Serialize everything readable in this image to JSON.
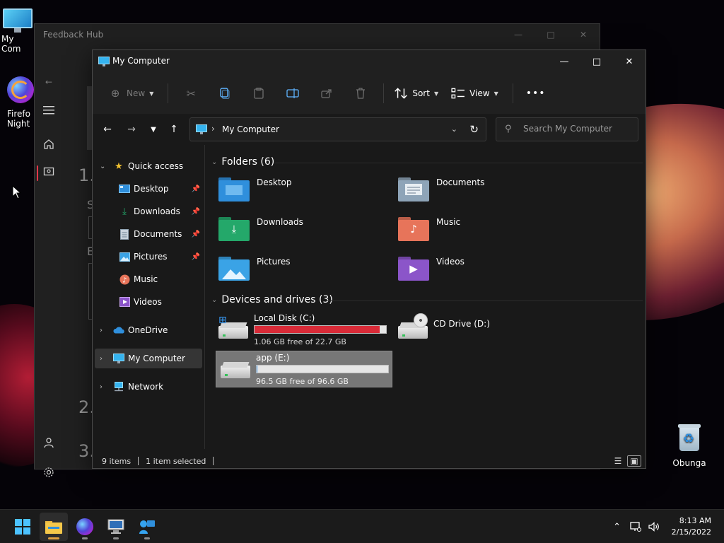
{
  "desktop": {
    "icons": [
      {
        "label": "My Com"
      },
      {
        "label": "Firefo"
      },
      {
        "label": "Night"
      },
      {
        "label": "Obunga"
      }
    ]
  },
  "feedback_hub": {
    "title": "Feedback Hub",
    "peek": {
      "step1": "1.",
      "step2": "2.",
      "step3": "3.",
      "letter_s": "S",
      "letter_e": "E"
    }
  },
  "explorer": {
    "title": "My Computer",
    "toolbar": {
      "new_label": "New",
      "sort_label": "Sort",
      "view_label": "View",
      "more_label": "•••"
    },
    "address": {
      "location": "My Computer"
    },
    "search": {
      "placeholder": "Search My Computer"
    },
    "nav": {
      "quick_access": "Quick access",
      "items": [
        {
          "label": "Desktop",
          "icon": "desktop-icon"
        },
        {
          "label": "Downloads",
          "icon": "downloads-icon"
        },
        {
          "label": "Documents",
          "icon": "documents-icon"
        },
        {
          "label": "Pictures",
          "icon": "pictures-icon"
        },
        {
          "label": "Music",
          "icon": "music-icon"
        },
        {
          "label": "Videos",
          "icon": "videos-icon"
        }
      ],
      "onedrive": "OneDrive",
      "my_computer": "My Computer",
      "network": "Network"
    },
    "folders_header": "Folders (6)",
    "folders": [
      {
        "label": "Desktop",
        "color": "#2f8fdc"
      },
      {
        "label": "Documents",
        "color": "#8ea4b8"
      },
      {
        "label": "Downloads",
        "color": "#24a86a"
      },
      {
        "label": "Music",
        "color": "#e7745a"
      },
      {
        "label": "Pictures",
        "color": "#3aa3e6"
      },
      {
        "label": "Videos",
        "color": "#8b55c9"
      }
    ],
    "drives_header": "Devices and drives (3)",
    "drives": [
      {
        "name": "Local Disk (C:)",
        "free": "1.06 GB free of 22.7 GB",
        "used_fraction": 0.953,
        "bar_color": "#d92b38"
      },
      {
        "name": "CD Drive (D:)"
      },
      {
        "name": "app (E:)",
        "free": "96.5 GB free of 96.6 GB",
        "used_fraction": 0.001,
        "bar_color": "#2e8be0"
      }
    ],
    "status": {
      "items": "9 items",
      "selected": "1 item selected"
    }
  },
  "taskbar": {
    "time": "8:13 AM",
    "date": "2/15/2022"
  }
}
